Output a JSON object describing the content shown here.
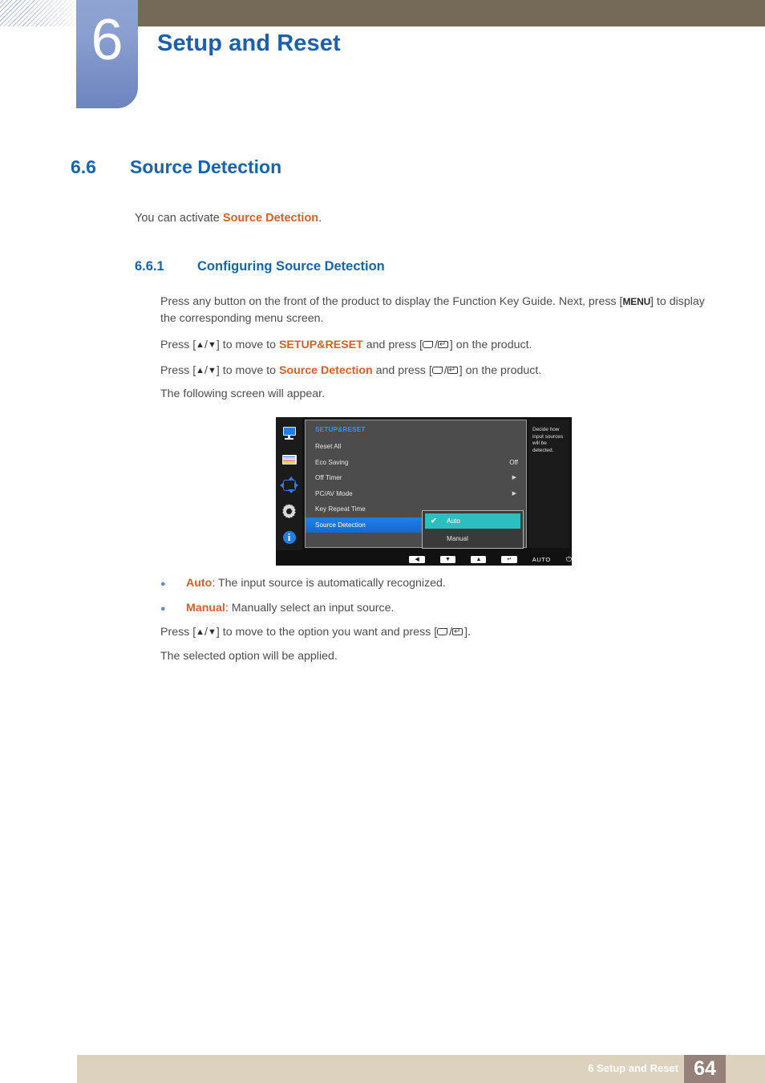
{
  "header": {
    "chapter_number": "6",
    "chapter_title": "Setup and Reset"
  },
  "section": {
    "number": "6.6",
    "title": "Source Detection",
    "intro_prefix": "You can activate ",
    "intro_highlight": "Source Detection",
    "intro_suffix": "."
  },
  "subsection": {
    "number": "6.6.1",
    "title": "Configuring Source Detection"
  },
  "body": {
    "p1_a": "Press any button on the front of the product to display the Function Key Guide. Next, press [",
    "p1_menu": "MENU",
    "p1_b": "] to display the corresponding menu screen.",
    "p2_a": "Press [",
    "p2_up": "▲",
    "p2_slash": "/",
    "p2_down": "▼",
    "p2_b": "] to move to ",
    "p2_target": "SETUP&RESET",
    "p2_c": " and press [",
    "p2_d": "] on the product.",
    "p3_target": "Source Detection",
    "p4": "The following screen will appear.",
    "p5_a": "Press [",
    "p5_b": "] to move to the option you want and press [",
    "p5_c": "].",
    "p6": "The selected option will be applied."
  },
  "bullets": [
    {
      "bullet": "●",
      "term": "Auto",
      "desc": ": The input source is automatically recognized."
    },
    {
      "bullet": "●",
      "term": "Manual",
      "desc": ": Manually select an input source."
    }
  ],
  "osd": {
    "menu_header": "SETUP&RESET",
    "icons": [
      {
        "name": "display-icon"
      },
      {
        "name": "color-bars-icon"
      },
      {
        "name": "size-position-icon"
      },
      {
        "name": "setup-gear-icon"
      },
      {
        "name": "information-icon"
      }
    ],
    "rows": [
      {
        "label": "Reset All",
        "value": "",
        "caret": ""
      },
      {
        "label": "Eco Saving",
        "value": "Off",
        "caret": ""
      },
      {
        "label": "Off Timer",
        "value": "",
        "caret": "▶"
      },
      {
        "label": "PC/AV Mode",
        "value": "",
        "caret": "▶"
      },
      {
        "label": "Key Repeat Time",
        "value": "",
        "caret": ""
      },
      {
        "label": "Source Detection",
        "value": "",
        "caret": ""
      }
    ],
    "submenu": [
      {
        "label": "Auto",
        "check": "✔",
        "active": true
      },
      {
        "label": "Manual",
        "check": "",
        "active": false
      }
    ],
    "help_text": "Decide how input sources will be detected.",
    "bottom_bar": {
      "btn_left": "◀",
      "btn_down": "▼",
      "btn_up": "▲",
      "btn_enter": "↵",
      "auto_label": "AUTO",
      "power_glyph": "⏻"
    }
  },
  "footer": {
    "text": "6 Setup and Reset",
    "page": "64"
  },
  "colors": {
    "heading_blue": "#1565ad",
    "title_blue": "#1f5fa9",
    "orange": "#d4602a",
    "brown_bar": "#756a58",
    "footer_beige": "#ddd2bd",
    "footer_page_box": "#96807a",
    "osd_select_blue": "#1f7fe8",
    "osd_submenu_teal": "#2dbfbf"
  }
}
